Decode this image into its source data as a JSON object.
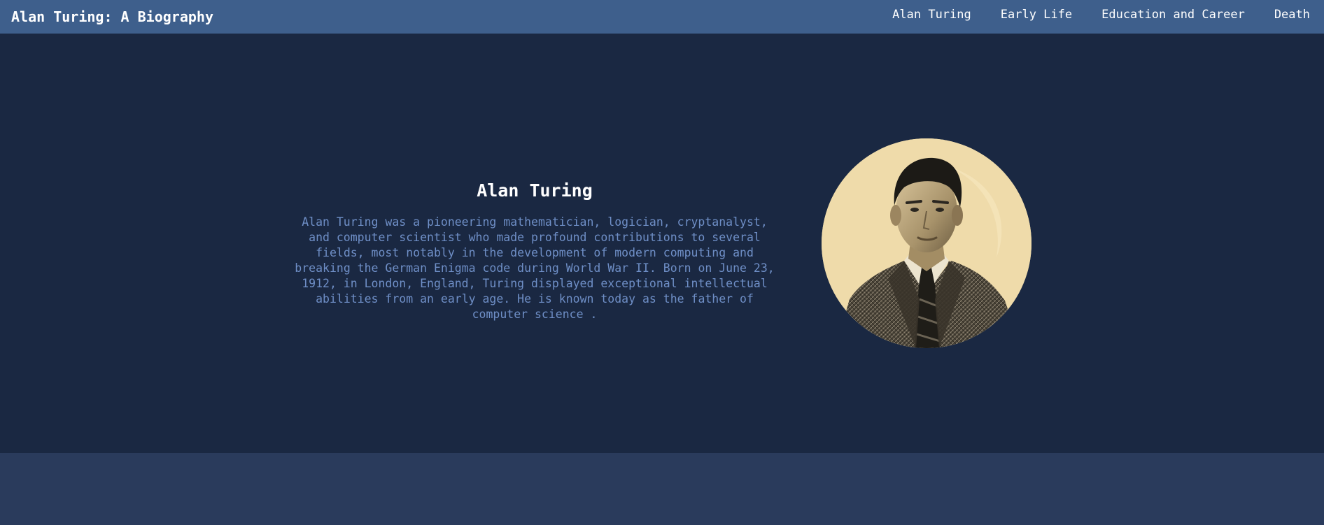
{
  "header": {
    "brand": "Alan Turing: A Biography",
    "nav": [
      {
        "label": "Alan Turing"
      },
      {
        "label": "Early Life"
      },
      {
        "label": "Education and Career"
      },
      {
        "label": "Death"
      }
    ]
  },
  "hero": {
    "title": "Alan Turing",
    "description": "Alan Turing was a pioneering mathematician, logician, cryptanalyst, and computer scientist who made profound contributions to several fields, most notably in the development of modern computing and breaking the German Enigma code during World War II. Born on June 23, 1912, in London, England, Turing displayed exceptional intellectual abilities from an early age. He is known today as the father of computer science ."
  },
  "colors": {
    "navbar": "#3e5f8c",
    "hero_background": "#1a2842",
    "footer_background": "#2a3b5c",
    "description_text": "#6f8fc7",
    "title_text": "#ffffff"
  }
}
